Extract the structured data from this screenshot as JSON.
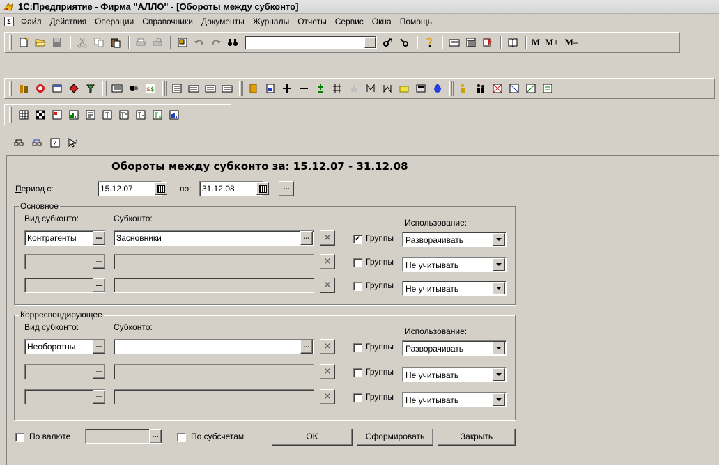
{
  "window_title": "1С:Предприятие - Фирма \"АЛЛО\" - [Обороты между субконто]",
  "menu": [
    "Файл",
    "Действия",
    "Операции",
    "Справочники",
    "Документы",
    "Журналы",
    "Отчеты",
    "Сервис",
    "Окна",
    "Помощь"
  ],
  "sys_menu_glyph": "Σ",
  "toolbar_text": {
    "m": "M",
    "mplus": "M+",
    "mminus": "M–"
  },
  "form": {
    "title": "Обороты между субконто за: 15.12.07 - 31.12.08",
    "period_label": "Период с:",
    "period_label_underline": "П",
    "period_label_rest": "ериод с:",
    "period_from": "15.12.07",
    "period_to_label": "по:",
    "period_to": "31.12.08",
    "more_button": "...",
    "group_main": "Основное",
    "group_corr": "Корреспондирующее",
    "vid_label": "Вид субконто:",
    "sub_label": "Субконто:",
    "use_label": "Использование:",
    "groups_label": "Группы",
    "main_rows": [
      {
        "vid": "Контрагенты",
        "sub": "Засновники",
        "groups_checked": "✓",
        "use": "Разворачивать"
      },
      {
        "vid": "",
        "sub": "",
        "groups_checked": "",
        "use": "Не учитывать"
      },
      {
        "vid": "",
        "sub": "",
        "groups_checked": "",
        "use": "Не учитывать"
      }
    ],
    "corr_rows": [
      {
        "vid": "Необоротны",
        "sub": "",
        "groups_checked": "",
        "use": "Разворачивать"
      },
      {
        "vid": "",
        "sub": "",
        "groups_checked": "",
        "use": "Не учитывать"
      },
      {
        "vid": "",
        "sub": "",
        "groups_checked": "",
        "use": "Не учитывать"
      }
    ],
    "currency_label": "По валюте",
    "subaccounts_label": "По субсчетам",
    "ok_button": "OK",
    "form_button": "Сформировать",
    "close_button": "Закрыть"
  }
}
